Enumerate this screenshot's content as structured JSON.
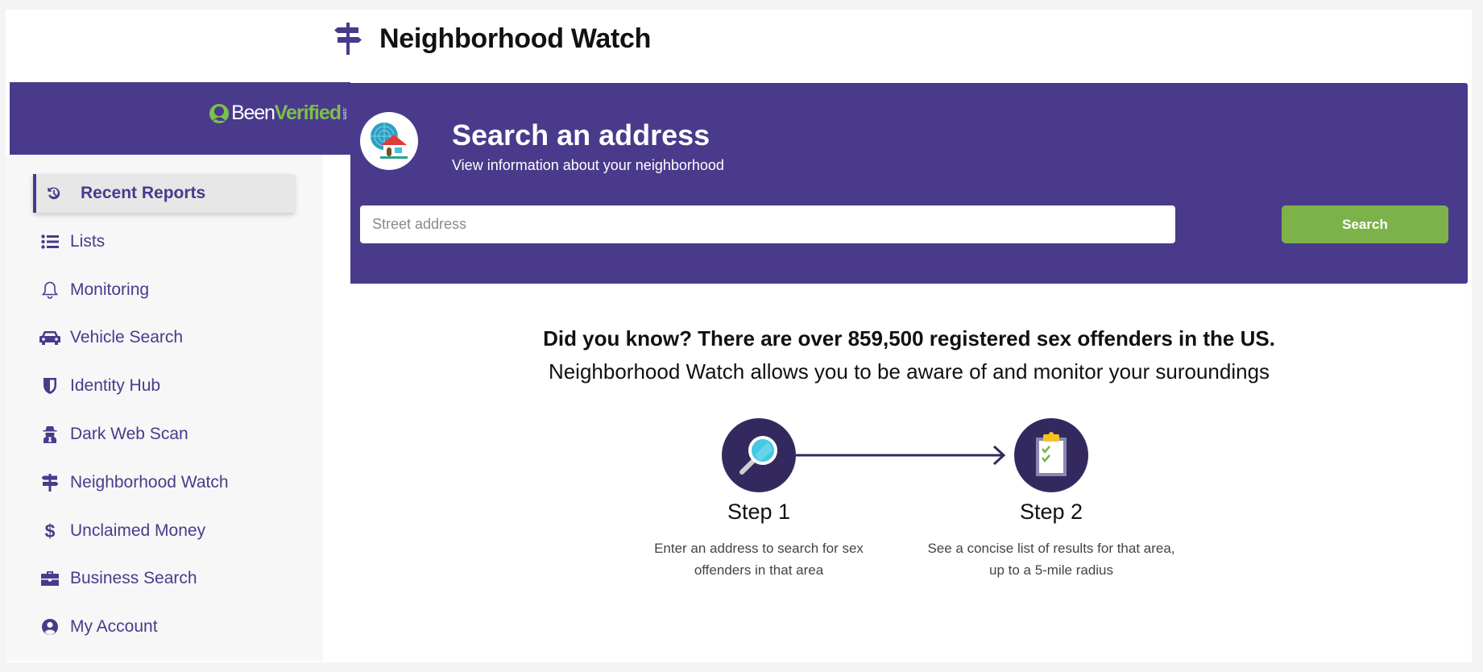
{
  "header": {
    "title": "Neighborhood Watch",
    "icon": "signpost-icon"
  },
  "brand": {
    "logo_part1": "Been",
    "logo_part2": "Verified",
    "logo_suffix": ".com",
    "colors": {
      "primary": "#4a3a8c",
      "accent_green": "#7db24a",
      "step_circle": "#34295f"
    }
  },
  "sidebar": {
    "items": [
      {
        "label": "Recent Reports",
        "icon": "history-icon",
        "active": true
      },
      {
        "label": "Lists",
        "icon": "list-icon"
      },
      {
        "label": "Monitoring",
        "icon": "bell-icon"
      },
      {
        "label": "Vehicle Search",
        "icon": "car-icon"
      },
      {
        "label": "Identity Hub",
        "icon": "shield-icon"
      },
      {
        "label": "Dark Web Scan",
        "icon": "spy-icon"
      },
      {
        "label": "Neighborhood Watch",
        "icon": "signpost-icon"
      },
      {
        "label": "Unclaimed Money",
        "icon": "dollar-icon"
      },
      {
        "label": "Business Search",
        "icon": "briefcase-icon"
      },
      {
        "label": "My Account",
        "icon": "user-circle-icon"
      }
    ]
  },
  "hero": {
    "title": "Search an address",
    "subtitle": "View information about your neighborhood",
    "input_placeholder": "Street address",
    "input_value": "",
    "search_label": "Search"
  },
  "info": {
    "line1": "Did you know? There are over 859,500 registered sex offenders in the US.",
    "line2": "Neighborhood Watch allows you to be aware of and monitor your suroundings"
  },
  "steps": [
    {
      "title": "Step 1",
      "description": "Enter an address to search for sex offenders in that area",
      "icon": "magnifier-icon"
    },
    {
      "title": "Step 2",
      "description": "See a concise list of results for that area, up to a 5-mile radius",
      "icon": "clipboard-icon"
    }
  ]
}
